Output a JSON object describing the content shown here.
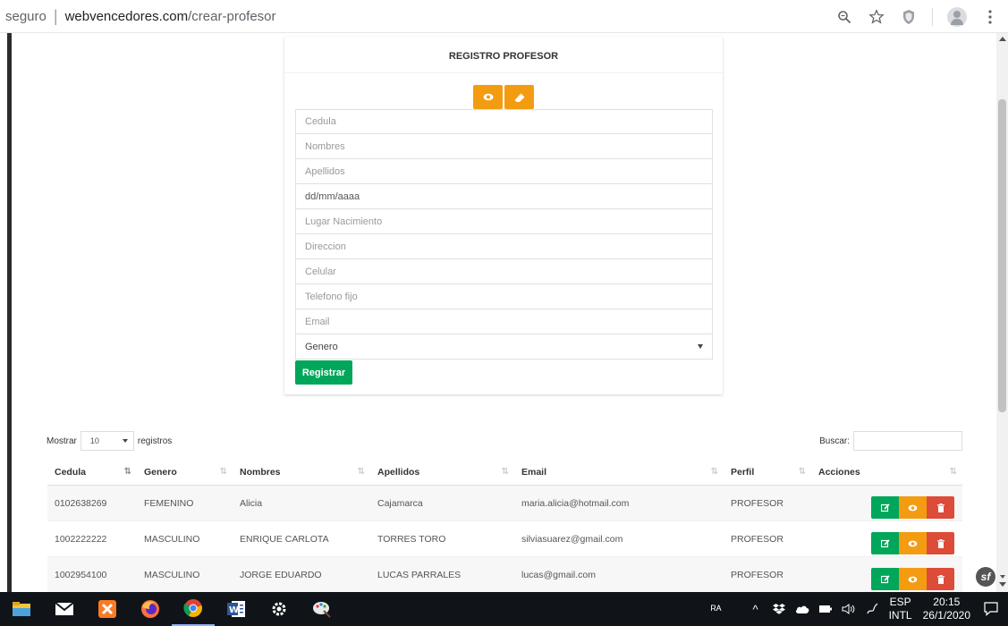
{
  "browser": {
    "secure_label": "seguro",
    "separator": "|",
    "url_host": "webvencedores.com",
    "url_path": "/crear-profesor"
  },
  "form": {
    "title": "REGISTRO PROFESOR",
    "fields": {
      "cedula": "Cedula",
      "nombres": "Nombres",
      "apellidos": "Apellidos",
      "fecha": "dd/mm/aaaa",
      "lugar": "Lugar Nacimiento",
      "direccion": "Direccion",
      "celular": "Celular",
      "telefono": "Telefono fijo",
      "email": "Email",
      "genero": "Genero"
    },
    "submit_label": "Registrar",
    "view_icon": "eye-icon",
    "clear_icon": "eraser-icon"
  },
  "table_controls": {
    "show_label": "Mostrar",
    "show_value": "10",
    "records_label": "registros",
    "search_label": "Buscar:"
  },
  "table": {
    "headers": [
      "Cedula",
      "Genero",
      "Nombres",
      "Apellidos",
      "Email",
      "Perfil",
      "Acciones"
    ],
    "rows": [
      [
        "0102638269",
        "FEMENINO",
        "Alicia",
        "Cajamarca",
        "maria.alicia@hotmail.com",
        "PROFESOR"
      ],
      [
        "1002222222",
        "MASCULINO",
        "ENRIQUE CARLOTA",
        "TORRES TORO",
        "silviasuarez@gmail.com",
        "PROFESOR"
      ],
      [
        "1002954100",
        "MASCULINO",
        "JORGE EDUARDO",
        "LUCAS PARRALES",
        "lucas@gmail.com",
        "PROFESOR"
      ]
    ]
  },
  "taskbar": {
    "lang_top": "ESP",
    "lang_bottom": "INTL",
    "time": "20:15",
    "date": "26/1/2020"
  },
  "colors": {
    "orange": "#f39c12",
    "green": "#00a65a",
    "red": "#dd4b39"
  }
}
